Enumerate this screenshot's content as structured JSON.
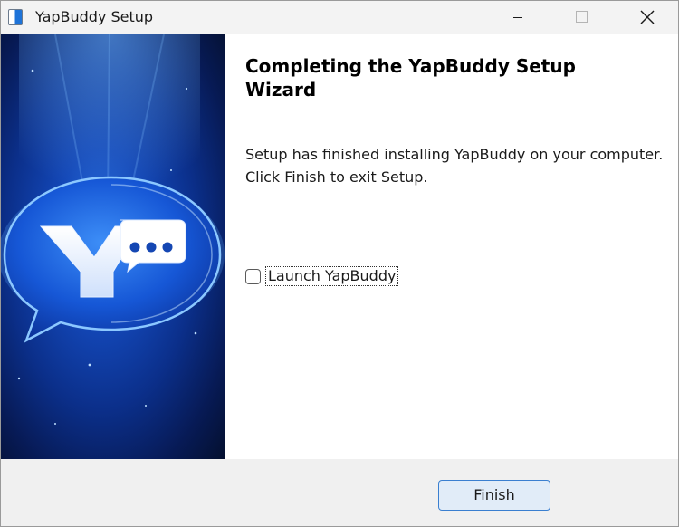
{
  "window": {
    "title": "YapBuddy Setup",
    "icon": "installer-app-icon",
    "controls": [
      "minimize-icon",
      "maximize-icon",
      "close-icon"
    ]
  },
  "banner": {
    "logo_icon": "yapbuddy-chat-bubble-logo",
    "colors": {
      "primary": "#1347b7",
      "dark": "#071a55",
      "glow": "#58a8ff"
    }
  },
  "content": {
    "heading": "Completing the YapBuddy Setup Wizard",
    "description_line1": "Setup has finished installing YapBuddy on your computer.",
    "description_line2": "Click Finish to exit Setup."
  },
  "launch_option": {
    "label": "Launch YapBuddy",
    "checked": false
  },
  "buttons": {
    "finish_label": "Finish"
  }
}
